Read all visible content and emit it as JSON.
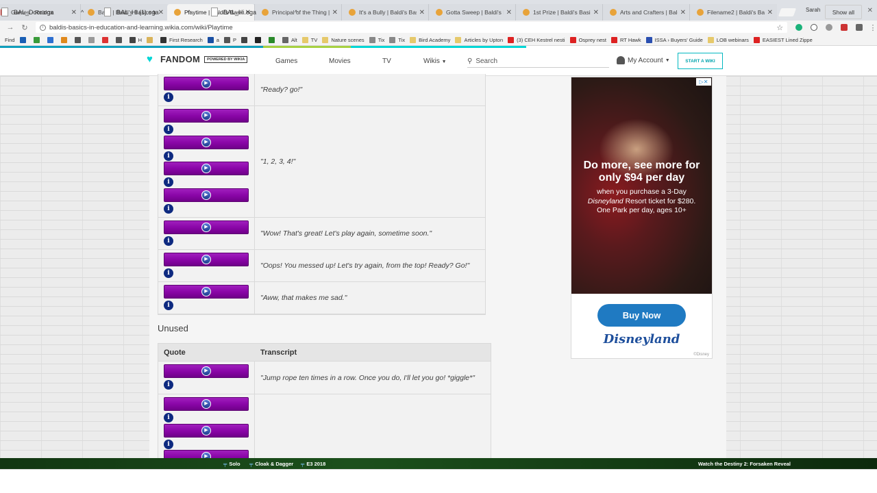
{
  "browser": {
    "tabs": [
      {
        "title": "Games - Roblox",
        "favicon": "roblox",
        "active": false
      },
      {
        "title": "Baldi | Baldi's Basics In E",
        "favicon": "fandom",
        "active": false
      },
      {
        "title": "Playtime | Baldi's Basics",
        "favicon": "fandom",
        "active": true
      },
      {
        "title": "Principal of the Thing | B",
        "favicon": "fandom",
        "active": false
      },
      {
        "title": "It's a Bully | Baldi's Basic",
        "favicon": "fandom",
        "active": false
      },
      {
        "title": "Gotta Sweep | Baldi's Ba",
        "favicon": "fandom",
        "active": false
      },
      {
        "title": "1st Prize | Baldi's Basics",
        "favicon": "fandom",
        "active": false
      },
      {
        "title": "Arts and Crafters | Baldi",
        "favicon": "fandom",
        "active": false
      },
      {
        "title": "Filename2 | Baldi's Basic",
        "favicon": "fandom",
        "active": false
      }
    ],
    "profile": "Sarah",
    "url": "baldis-basics-in-education-and-learning.wikia.com/wiki/Playtime",
    "bookmarks": [
      "Find",
      "",
      "",
      "",
      "",
      "",
      "",
      "",
      "",
      "H",
      "",
      "First Research",
      "a",
      "P",
      "",
      "",
      "",
      "Alt",
      "TV",
      "Nature scenes",
      "Tix",
      "Tix",
      "Bird Academy",
      "Articles by Upton",
      "(3) CEH Kestrel nesti",
      "Osprey nest",
      "RT Hawk",
      "ISSA › Buyers' Guide",
      "LOB webinars",
      "EASIEST Lined Zippe"
    ]
  },
  "fandom": {
    "logo": "FANDOM",
    "powered": "POWERED BY WIKIA",
    "nav": [
      "Games",
      "Movies",
      "TV",
      "Wikis"
    ],
    "search_placeholder": "Search",
    "my_account": "My Account",
    "start_wiki": "START A WIKI"
  },
  "quotes": [
    {
      "players": 1,
      "text": "\"Ready? go!\""
    },
    {
      "players": 4,
      "text": "\"1, 2, 3, 4!\""
    },
    {
      "players": 1,
      "text": "\"Wow! That's great! Let's play again, sometime soon.\""
    },
    {
      "players": 1,
      "text": "\"Oops! You messed up! Let's try again, from the top! Ready? Go!\""
    },
    {
      "players": 1,
      "text": "\"Aww, that makes me sad.\""
    }
  ],
  "unused": {
    "heading": "Unused",
    "col_quote": "Quote",
    "col_transcript": "Transcript",
    "rows": [
      {
        "players": 1,
        "text": "\"Jump rope ten times in a row. Once you do, I'll let you go! *giggle*\""
      },
      {
        "players": 3,
        "text": ""
      }
    ]
  },
  "ad": {
    "headline": "Do more, see more for only $94 per day",
    "sub_1": "when you purchase a 3-Day",
    "sub_brand": "Disneyland",
    "sub_2": "Resort ticket for $280.",
    "sub_3": "One Park per day, ages 10+",
    "button": "Buy Now",
    "brand": "Disneyland",
    "copyright": "©Disney"
  },
  "bottom_bar": {
    "items": [
      "Solo",
      "Cloak & Dagger",
      "E3 2018"
    ],
    "promo": "Watch the Destiny 2: Forsaken Reveal"
  },
  "downloads": {
    "files": [
      "BAL_Door.oga",
      "BAL_Hi (1).oga",
      "BAL_Hi.oga"
    ],
    "show_all": "Show all"
  }
}
